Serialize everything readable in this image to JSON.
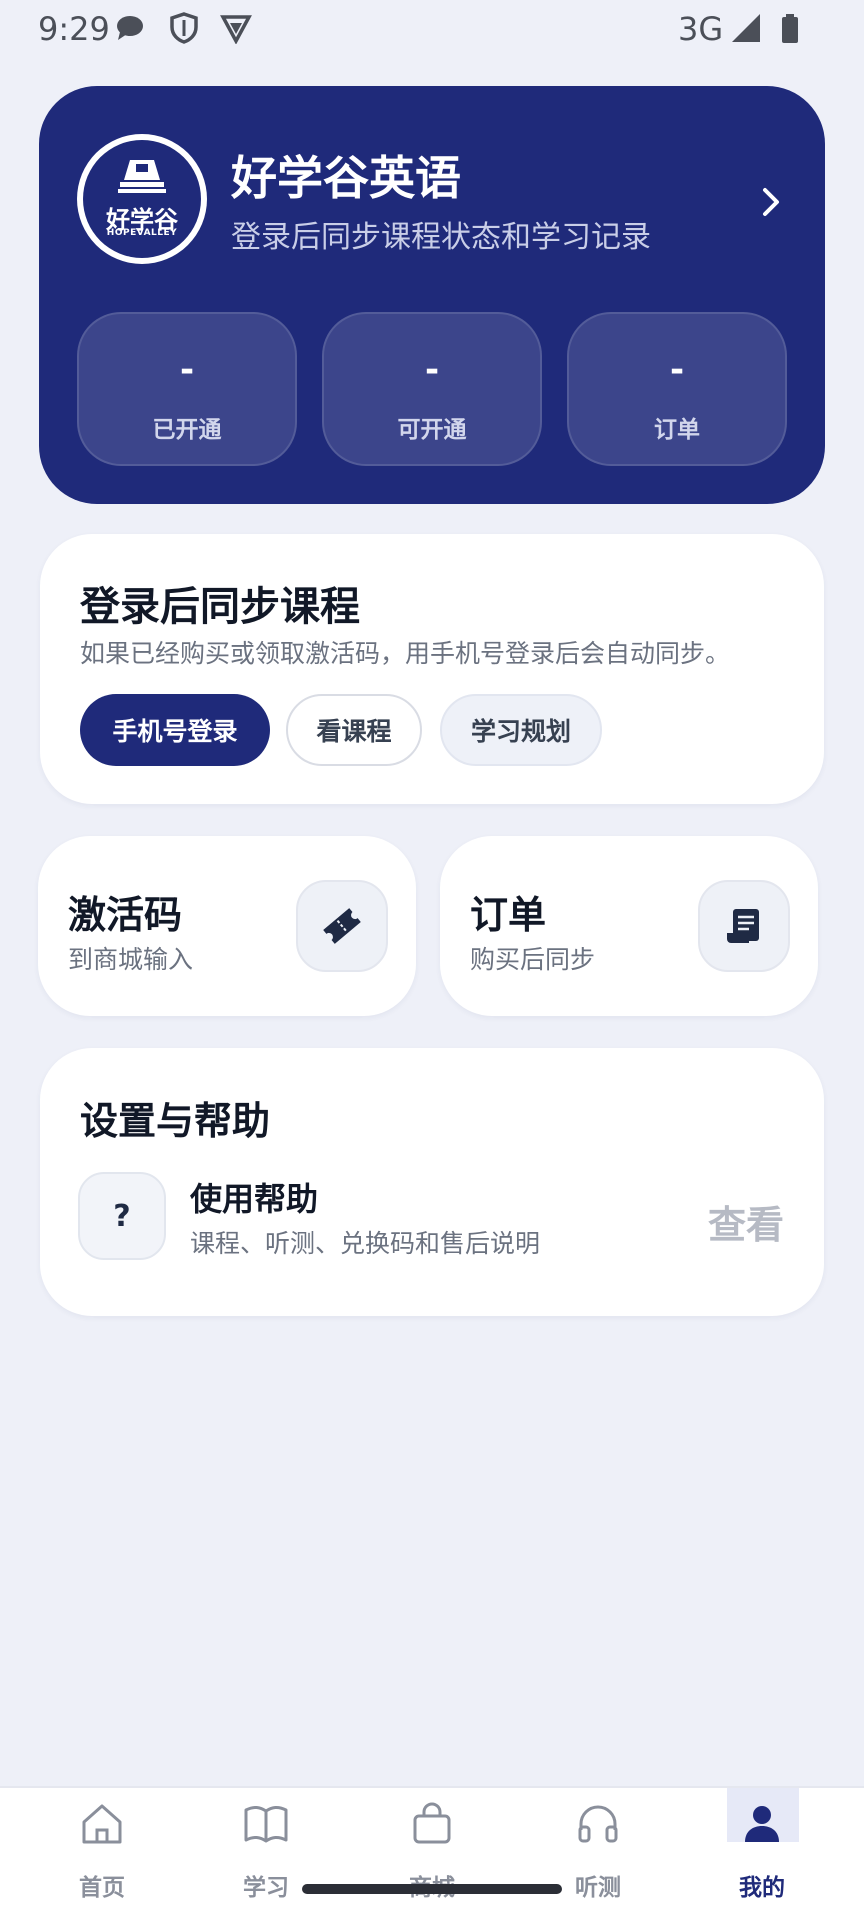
{
  "status_bar": {
    "time": "9:29",
    "network": "3G",
    "icons": [
      "chat-bubble-icon",
      "shield-icon",
      "vpn-icon",
      "signal-icon",
      "battery-icon"
    ]
  },
  "hero": {
    "logo": {
      "cn": "好学谷",
      "en": "HOPEVALLEY"
    },
    "title": "好学谷英语",
    "subtitle": "登录后同步课程状态和学习记录",
    "stats": [
      {
        "value": "-",
        "label": "已开通"
      },
      {
        "value": "-",
        "label": "可开通"
      },
      {
        "value": "-",
        "label": "订单"
      }
    ]
  },
  "sync_card": {
    "title": "登录后同步课程",
    "description": "如果已经购买或领取激活码，用手机号登录后会自动同步。",
    "buttons": {
      "login": "手机号登录",
      "courses": "看课程",
      "plan": "学习规划"
    }
  },
  "activation_card": {
    "title": "激活码",
    "subtitle": "到商城输入",
    "icon": "ticket-icon"
  },
  "orders_card": {
    "title": "订单",
    "subtitle": "购买后同步",
    "icon": "receipt-icon"
  },
  "settings": {
    "title": "设置与帮助",
    "help": {
      "icon_glyph": "?",
      "title": "使用帮助",
      "subtitle": "课程、听测、兑换码和售后说明",
      "action": "查看"
    }
  },
  "bottom_nav": {
    "items": [
      {
        "label": "首页",
        "icon": "home-icon"
      },
      {
        "label": "学习",
        "icon": "book-icon"
      },
      {
        "label": "商城",
        "icon": "shopping-bag-icon"
      },
      {
        "label": "听测",
        "icon": "headphones-icon"
      },
      {
        "label": "我的",
        "icon": "user-icon"
      }
    ],
    "active": "我的"
  },
  "colors": {
    "brand": "#1f2a7a",
    "background": "#eef0f8",
    "muted": "#6b7280"
  }
}
